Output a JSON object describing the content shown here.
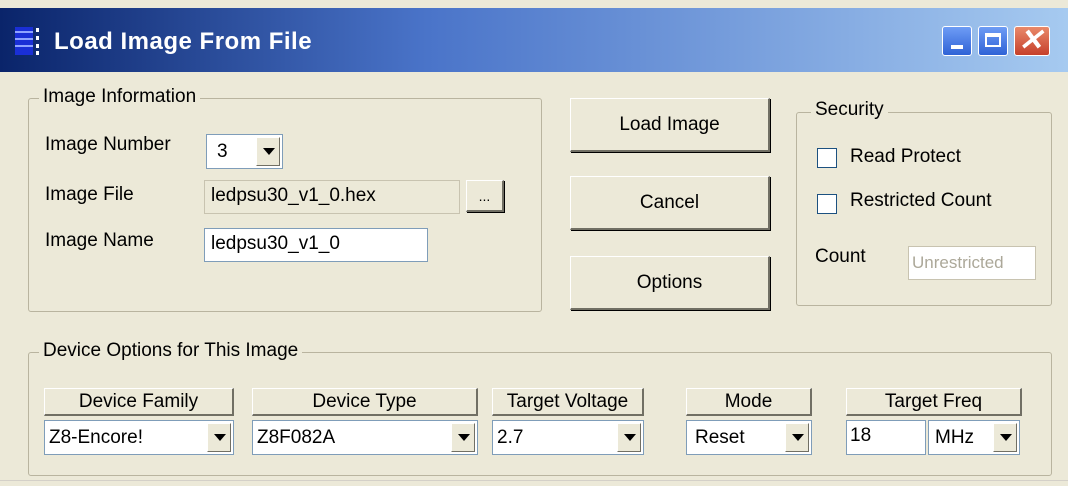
{
  "window": {
    "title": "Load Image From File",
    "icon": "app-icon",
    "controls": {
      "minimize": "minimize-icon",
      "maximize": "maximize-icon",
      "close": "close-icon"
    }
  },
  "image_info": {
    "legend": "Image Information",
    "image_number_label": "Image Number",
    "image_number_value": "3",
    "image_file_label": "Image File",
    "image_file_value": "ledpsu30_v1_0.hex",
    "browse_label": "...",
    "image_name_label": "Image Name",
    "image_name_value": "ledpsu30_v1_0"
  },
  "actions": {
    "load": "Load Image",
    "cancel": "Cancel",
    "options": "Options"
  },
  "security": {
    "legend": "Security",
    "read_protect_label": "Read Protect",
    "read_protect_checked": false,
    "restricted_count_label": "Restricted Count",
    "restricted_count_checked": false,
    "count_label": "Count",
    "count_value": "Unrestricted"
  },
  "device_options": {
    "legend": "Device Options for This Image",
    "family_label": "Device Family",
    "family_value": "Z8-Encore!",
    "type_label": "Device Type",
    "type_value": "Z8F082A",
    "voltage_label": "Target Voltage",
    "voltage_value": "2.7",
    "mode_label": "Mode",
    "mode_value": "Reset",
    "freq_label": "Target Freq",
    "freq_value": "18",
    "freq_unit": "MHz"
  }
}
